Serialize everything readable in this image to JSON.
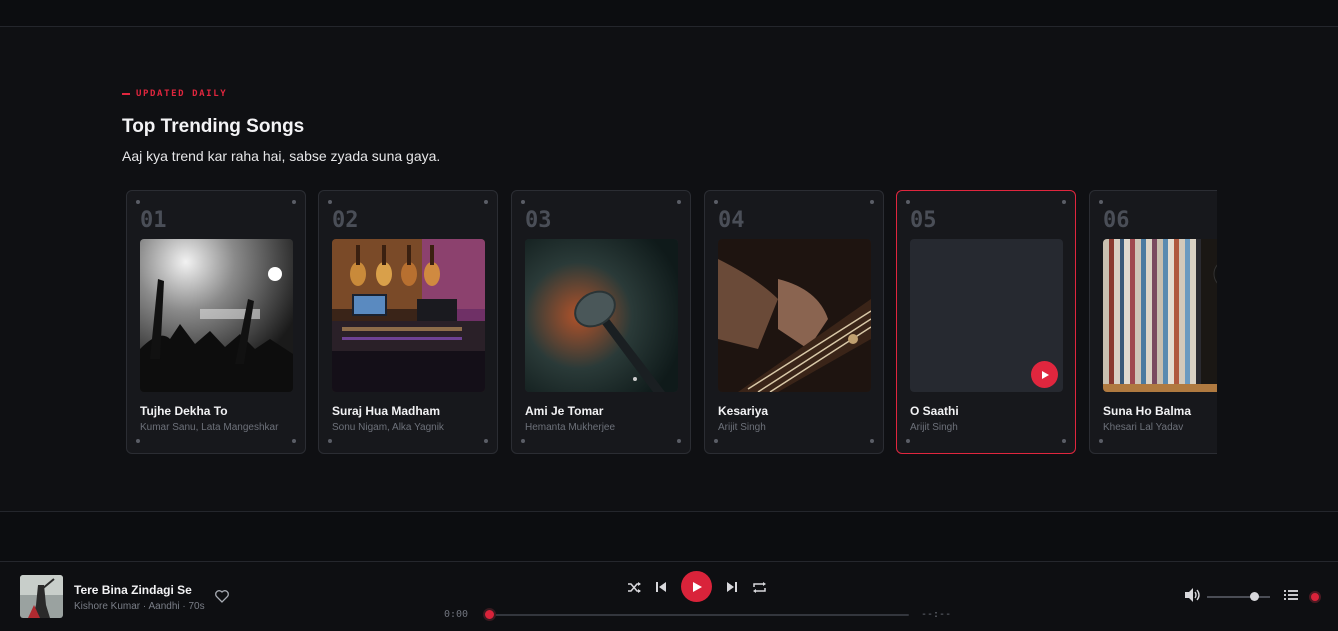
{
  "section": {
    "eyebrow": "UPDATED DAILY",
    "title": "Top Trending Songs",
    "subtitle": "Aaj kya trend kar raha hai, sabse zyada suna gaya."
  },
  "cards": [
    {
      "rank": "01",
      "title": "Tujhe Dekha To",
      "artist": "Kumar Sanu, Lata Mangeshkar",
      "art": "concert-crowd-bw"
    },
    {
      "rank": "02",
      "title": "Suraj Hua Madham",
      "artist": "Sonu Nigam, Alka Yagnik",
      "art": "music-studio-guitars"
    },
    {
      "rank": "03",
      "title": "Ami Je Tomar",
      "artist": "Hemanta Mukherjee",
      "art": "microphone"
    },
    {
      "rank": "04",
      "title": "Kesariya",
      "artist": "Arijit Singh",
      "art": "guitar-strings"
    },
    {
      "rank": "05",
      "title": "O Saathi",
      "artist": "Arijit Singh",
      "art": "empty-placeholder",
      "active": true
    },
    {
      "rank": "06",
      "title": "Suna Ho Balma",
      "artist": "Khesari Lal Yadav",
      "art": "vinyl-records"
    }
  ],
  "player": {
    "title": "Tere Bina Zindagi Se",
    "subtitle": "Kishore Kumar · Aandhi · 70s",
    "time_current": "0:00",
    "time_total": "--:--",
    "progress": 0,
    "volume": 0.75
  },
  "colors": {
    "accent": "#e0263e",
    "background": "#0c0d10",
    "card": "#17181c"
  }
}
